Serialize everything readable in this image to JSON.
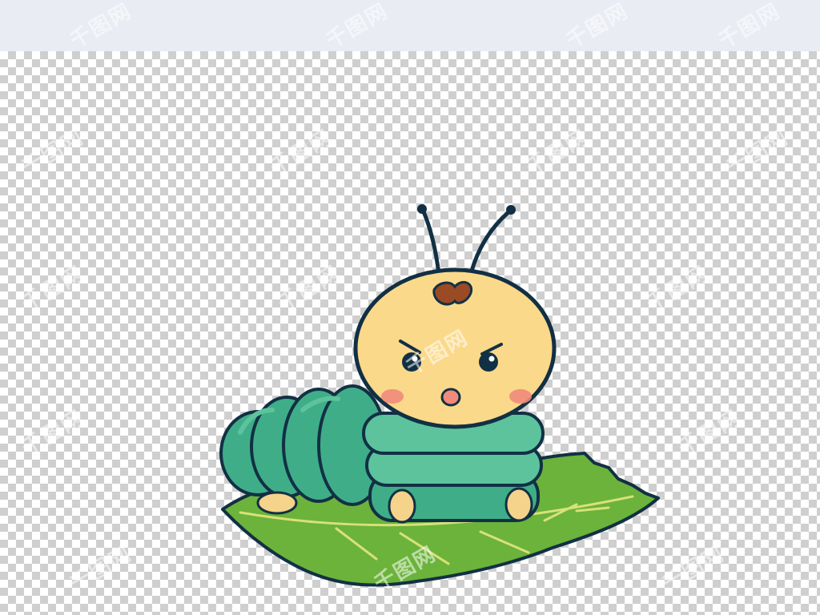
{
  "image": {
    "subject": "caterpillar-on-leaf",
    "background": "transparency-checkerboard",
    "colors": {
      "top_band": "#e9ecf3",
      "checker_dark": "#cfcfcf",
      "checker_light": "#ffffff",
      "outline": "#123044",
      "body_green": "#3fae88",
      "body_green_light": "#5cc39d",
      "head_yellow": "#fbd98a",
      "cheek_pink": "#f08a7a",
      "hair_brown": "#9a4a24",
      "leaf_green": "#6bb33a",
      "leaf_vein": "#d8e07a",
      "feet": "#f5d38a"
    },
    "watermark_text": "千图网"
  }
}
